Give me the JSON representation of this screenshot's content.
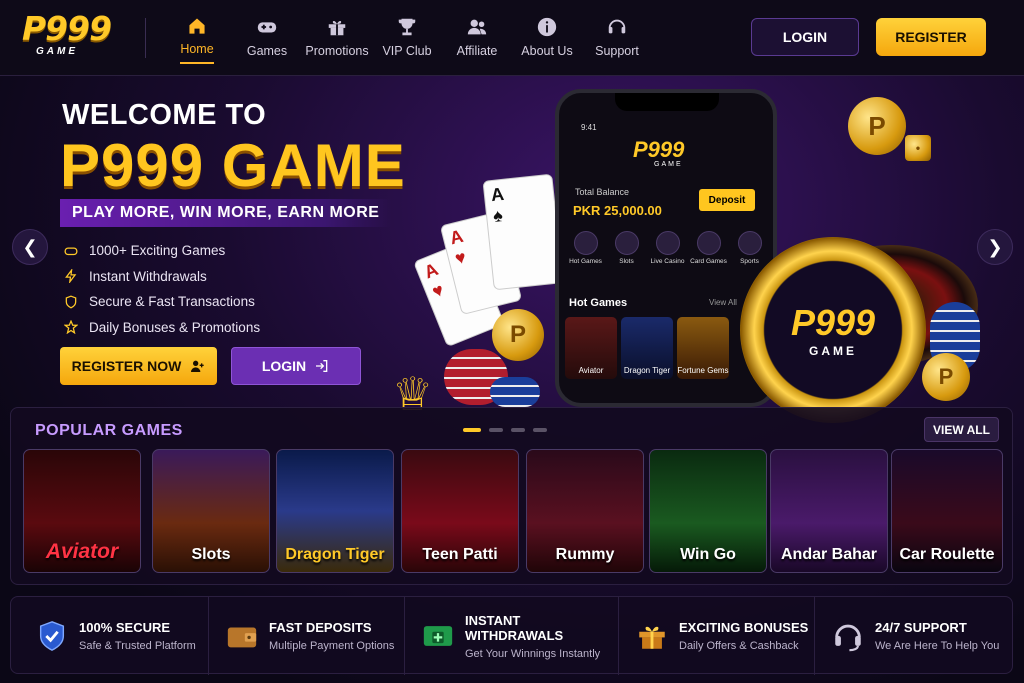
{
  "logo": {
    "main": "P999",
    "sub": "GAME"
  },
  "nav": [
    {
      "label": "Home",
      "icon": "home-icon",
      "active": true
    },
    {
      "label": "Games",
      "icon": "gamepad-icon"
    },
    {
      "label": "Promotions",
      "icon": "gift-icon"
    },
    {
      "label": "VIP Club",
      "icon": "trophy-icon"
    },
    {
      "label": "Affiliate",
      "icon": "users-icon"
    },
    {
      "label": "About Us",
      "icon": "info-icon"
    },
    {
      "label": "Support",
      "icon": "headset-icon"
    }
  ],
  "header": {
    "login": "LOGIN",
    "register": "REGISTER"
  },
  "hero": {
    "welcome": "WELCOME TO",
    "title": "P999 GAME",
    "tagline": "PLAY MORE, WIN MORE, EARN MORE",
    "features": [
      "1000+ Exciting Games",
      "Instant Withdrawals",
      "Secure & Fast Transactions",
      "Daily Bonuses & Promotions"
    ],
    "register_now": "REGISTER NOW",
    "login": "LOGIN"
  },
  "phone": {
    "time": "9:41",
    "logo": "P999",
    "logo_sub": "GAME",
    "balance_label": "Total Balance",
    "balance_value": "PKR 25,000.00",
    "deposit": "Deposit",
    "categories": [
      "Hot Games",
      "Slots",
      "Live Casino",
      "Card Games",
      "Sports"
    ],
    "hot_games": "Hot Games",
    "view_all": "View All",
    "tiles": [
      "Aviator",
      "Dragon Tiger",
      "Fortune Gems"
    ]
  },
  "chip": {
    "main": "P999",
    "sub": "GAME"
  },
  "popular": {
    "title": "POPULAR GAMES",
    "view_all": "VIEW ALL",
    "games": [
      "Aviator",
      "Slots",
      "Dragon Tiger",
      "Teen Patti",
      "Rummy",
      "Win Go",
      "Andar Bahar",
      "Car Roulette"
    ]
  },
  "perks": [
    {
      "title": "100% SECURE",
      "sub": "Safe & Trusted Platform",
      "icon": "shield-icon"
    },
    {
      "title": "FAST DEPOSITS",
      "sub": "Multiple Payment Options",
      "icon": "wallet-icon"
    },
    {
      "title": "INSTANT WITHDRAWALS",
      "sub": "Get Your Winnings Instantly",
      "icon": "cash-icon"
    },
    {
      "title": "EXCITING BONUSES",
      "sub": "Daily Offers & Cashback",
      "icon": "gift-icon"
    },
    {
      "title": "24/7 SUPPORT",
      "sub": "We Are Here To Help You",
      "icon": "headset-icon"
    }
  ],
  "colors": {
    "accent": "#ffc928",
    "purple": "#6b2fb3",
    "background": "#0b0716"
  }
}
